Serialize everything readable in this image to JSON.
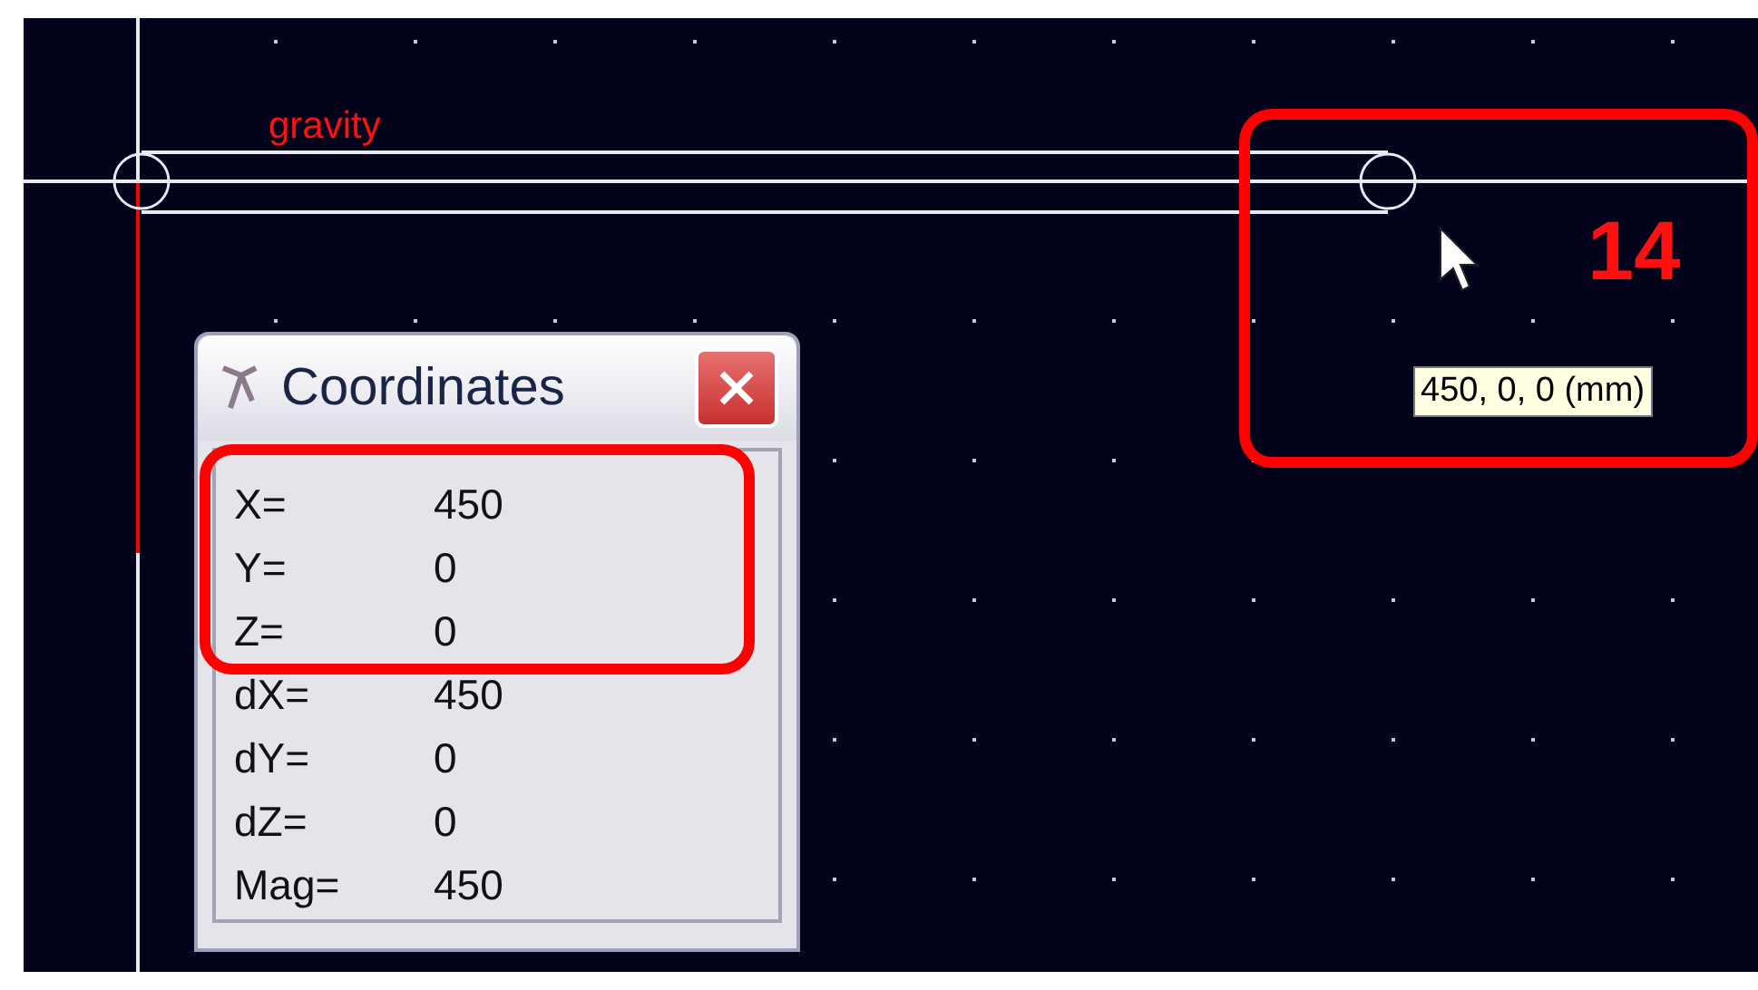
{
  "canvas": {
    "label": "gravity",
    "step_number": "14",
    "tooltip": "450, 0, 0 (mm)"
  },
  "dialog": {
    "title": "Coordinates",
    "rows": [
      {
        "label": "X=",
        "value": "450"
      },
      {
        "label": "Y=",
        "value": "0"
      },
      {
        "label": "Z=",
        "value": "0"
      },
      {
        "label": "dX=",
        "value": "450"
      },
      {
        "label": "dY=",
        "value": "0"
      },
      {
        "label": "dZ=",
        "value": "0"
      },
      {
        "label": "Mag=",
        "value": "450"
      }
    ]
  }
}
